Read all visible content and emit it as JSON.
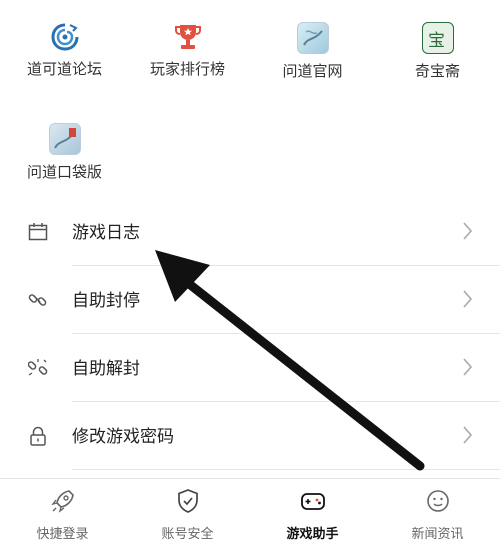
{
  "apps_row1": [
    {
      "label": "道可道论坛",
      "icon": "forum-logo-icon"
    },
    {
      "label": "玩家排行榜",
      "icon": "trophy-icon"
    },
    {
      "label": "问道官网",
      "icon": "official-site-icon"
    },
    {
      "label": "奇宝斋",
      "icon": "treasure-shop-icon",
      "glyph": "宝"
    }
  ],
  "apps_row2": [
    {
      "label": "问道口袋版",
      "icon": "pocket-edition-icon"
    }
  ],
  "menu": [
    {
      "label": "游戏日志",
      "icon": "calendar-icon"
    },
    {
      "label": "自助封停",
      "icon": "link-lock-icon"
    },
    {
      "label": "自助解封",
      "icon": "link-unlock-icon"
    },
    {
      "label": "修改游戏密码",
      "icon": "padlock-icon"
    }
  ],
  "tabs": [
    {
      "label": "快捷登录",
      "icon": "rocket-icon",
      "active": false
    },
    {
      "label": "账号安全",
      "icon": "shield-check-icon",
      "active": false
    },
    {
      "label": "游戏助手",
      "icon": "gamepad-icon",
      "active": true
    },
    {
      "label": "新闻资讯",
      "icon": "news-icon",
      "active": false
    }
  ],
  "colors": {
    "trophy": "#e0513f",
    "logo_blue": "#2a6fb0",
    "divider": "#e6e6e6",
    "arrow": "#111111"
  }
}
